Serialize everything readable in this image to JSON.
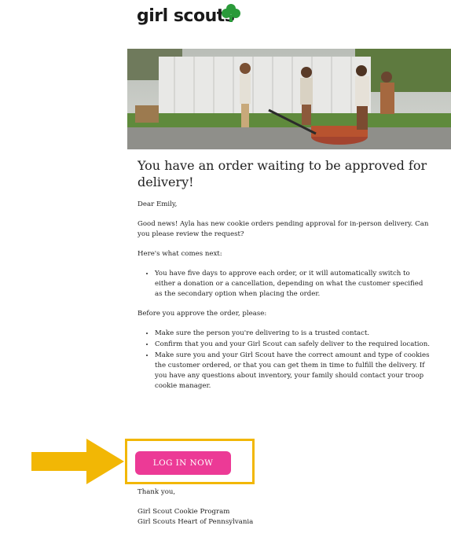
{
  "brand": {
    "logo_text": "girl scouts"
  },
  "email": {
    "title": "You have an order waiting to be approved for delivery!",
    "greeting": "Dear Emily,",
    "intro": "Good news! Ayla has new cookie orders pending approval for in-person delivery. Can you please review the request?",
    "next_heading": "Here's what comes next:",
    "next_items": [
      "You have five days to approve each order, or it will automatically switch to either a donation or a cancellation, depending on what the customer specified as the secondary option when placing the order."
    ],
    "before_heading": "Before you approve the order, please:",
    "before_items": [
      "Make sure the person you're delivering to is a trusted contact.",
      "Confirm that you and your Girl Scout can safely deliver to the required location.",
      "Make sure you and your Girl Scout have the correct amount and type of cookies the customer ordered, or that you can get them in time to fulfill the delivery. If you have any questions about inventory, your family should contact your troop cookie manager."
    ],
    "cta_label": "LOG IN NOW",
    "closing": "Thank you,",
    "signature": [
      "Girl Scout Cookie Program",
      "Girl Scouts Heart of Pennsylvania"
    ]
  },
  "colors": {
    "cta": "#ec3a96",
    "highlight": "#f2b705",
    "logo_trefoil": "#2a9a3a"
  }
}
